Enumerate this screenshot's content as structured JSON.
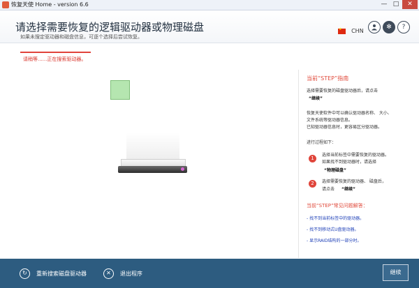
{
  "window": {
    "title": "恢复天使 Home - version 6.6",
    "minimize_glyph": "—",
    "maximize_glyph": "□",
    "close_glyph": "✕"
  },
  "header": {
    "title": "请选择需要恢复的逻辑驱动器或物理磁盘",
    "subtitle": "如果未搜定驱动器和磁盘信息，可逐个选择后尝试恢复。",
    "language": "CHN",
    "icons": [
      "user-icon",
      "gear-icon",
      "question-icon"
    ]
  },
  "status": {
    "text": "请稍等......正在搜索驱动器。"
  },
  "guide": {
    "title": "当前“STEP”指南",
    "intro_line1": "选择需要恢复的磁盘驱动器后，请点击",
    "intro_continue": "“继续”",
    "info_line1": "恢复天使软件中可以确认驱动器名称、 大小、",
    "info_line2": "文件系统等驱动器信息。",
    "info_line3": "已知驱动器信息时，更容易区分驱动器。",
    "process_title": "进行过程如下：",
    "step1_number": "1",
    "step1_line1": "选择当前标签中需要恢复的驱动器。",
    "step1_line2": "如果找不到驱动器时，请选择",
    "step1_bold": "“物理磁盘”",
    "step2_number": "2",
    "step2_line1": "选择需要恢复的驱动器、 磁盘后，",
    "step2_line2": "请点击",
    "step2_bold": "“继续”",
    "faq_title": "当前“STEP”常见问题解答：",
    "faq": [
      "- 找不到当前标签中的驱动器。",
      "- 找不到移动式U盘驱动器。",
      "- 显示RAID结构的一部分时。"
    ]
  },
  "footer": {
    "rescan_label": "重新搜索磁盘驱动器",
    "exit_label": "退出程序",
    "continue_label": "继续"
  },
  "colors": {
    "accent_red": "#e0433b",
    "footer_blue": "#2d5c80",
    "faq_blue": "#1d3fb7"
  }
}
